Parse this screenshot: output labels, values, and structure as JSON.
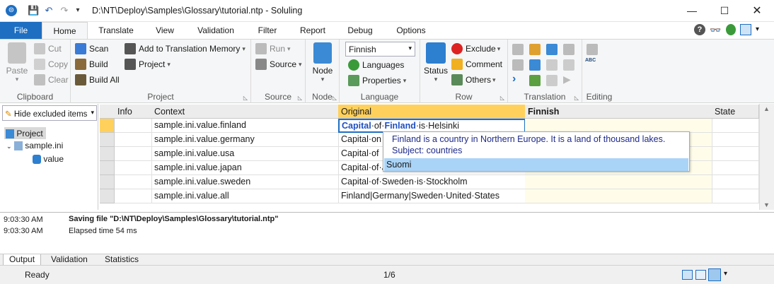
{
  "window": {
    "title": "D:\\NT\\Deploy\\Samples\\Glossary\\tutorial.ntp  -  Soluling"
  },
  "tabs": [
    {
      "label": "File"
    },
    {
      "label": "Home"
    },
    {
      "label": "Translate"
    },
    {
      "label": "View"
    },
    {
      "label": "Validation"
    },
    {
      "label": "Filter"
    },
    {
      "label": "Report"
    },
    {
      "label": "Debug"
    },
    {
      "label": "Options"
    }
  ],
  "ribbon": {
    "clipboard": {
      "label": "Clipboard",
      "paste": "Paste",
      "cut": "Cut",
      "copy": "Copy",
      "clear": "Clear"
    },
    "project": {
      "label": "Project",
      "scan": "Scan",
      "build": "Build",
      "build_all": "Build All",
      "add_tm": "Add to Translation Memory",
      "project_menu": "Project"
    },
    "source": {
      "label": "Source",
      "run": "Run",
      "source_menu": "Source"
    },
    "node": {
      "label": "Node",
      "node_btn": "Node"
    },
    "language": {
      "label": "Language",
      "selected": "Finnish",
      "languages": "Languages",
      "properties": "Properties"
    },
    "row": {
      "label": "Row",
      "status": "Status",
      "exclude": "Exclude",
      "comment": "Comment",
      "others": "Others"
    },
    "translation": {
      "label": "Translation"
    },
    "editing": {
      "label": "Editing",
      "abc": "ABC"
    }
  },
  "left": {
    "filter": "Hide excluded items",
    "tree": [
      "Project",
      "sample.ini",
      "value"
    ]
  },
  "grid": {
    "headers": [
      "Info",
      "Context",
      "Original",
      "Finnish",
      "State"
    ],
    "rows": [
      {
        "context": "sample.ini.value.finland",
        "original": "Capital·of·Finland·is·Helsinki"
      },
      {
        "context": "sample.ini.value.germany",
        "original": "Capital·on"
      },
      {
        "context": "sample.ini.value.usa",
        "original": "Capital·of"
      },
      {
        "context": "sample.ini.value.japan",
        "original": "Capital·of·J"
      },
      {
        "context": "sample.ini.value.sweden",
        "original": "Capital·of·Sweden·is·Stockholm"
      },
      {
        "context": "sample.ini.value.all",
        "original": "Finland|Germany|Sweden·United·States"
      }
    ],
    "highlight": {
      "a": "Capital",
      "b": "·of·",
      "c": "Finland",
      "d": "·is·Helsinki"
    }
  },
  "popup": {
    "line1": "Finland is a country in Northern Europe. It is a land of thousand lakes.",
    "line2": "Subject: countries",
    "suggestion": "Suomi"
  },
  "output": {
    "log": [
      {
        "time": "9:03:30 AM",
        "msg": "Saving file \"D:\\NT\\Deploy\\Samples\\Glossary\\tutorial.ntp\""
      },
      {
        "time": "9:03:30 AM",
        "msg": "Elapsed time 54 ms"
      }
    ]
  },
  "output_tabs": [
    "Output",
    "Validation",
    "Statistics"
  ],
  "status": {
    "left": "Ready",
    "center": "1/6"
  },
  "colors": {
    "accent": "#1e6fc2",
    "selected_header": "#ffd15c",
    "popup_select": "#aad4f7"
  }
}
